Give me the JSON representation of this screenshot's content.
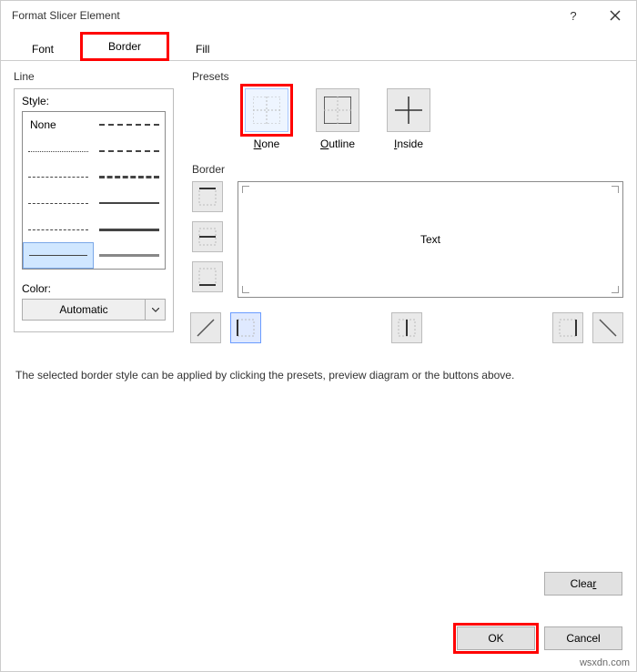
{
  "title": "Format Slicer Element",
  "tabs": {
    "font": "Font",
    "border": "Border",
    "fill": "Fill"
  },
  "line": {
    "group": "Line",
    "style_label": "Style:",
    "none": "None",
    "color_label": "Color:",
    "color_value": "Automatic"
  },
  "presets": {
    "group": "Presets",
    "none": "None",
    "outline": "Outline",
    "inside": "Inside"
  },
  "border": {
    "group": "Border",
    "preview_text": "Text"
  },
  "hint": "The selected border style can be applied by clicking the presets, preview diagram or the buttons above.",
  "buttons": {
    "clear": "Clear",
    "ok": "OK",
    "cancel": "Cancel"
  },
  "watermark": "wsxdn.com"
}
